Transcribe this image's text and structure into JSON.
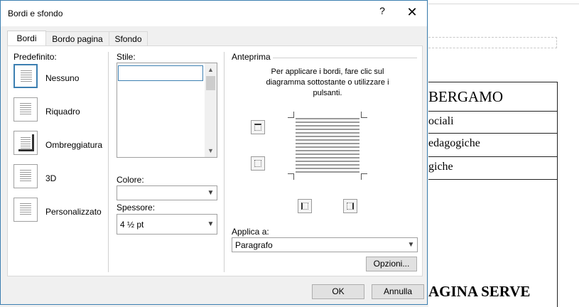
{
  "dialog": {
    "title": "Bordi e sfondo",
    "help": "?",
    "close": "✕"
  },
  "tabs": [
    {
      "label": "Bordi"
    },
    {
      "label": "Bordo pagina"
    },
    {
      "label": "Sfondo"
    }
  ],
  "presets": {
    "label": "Predefinito:",
    "items": [
      {
        "label": "Nessuno"
      },
      {
        "label": "Riquadro"
      },
      {
        "label": "Ombreggiatura"
      },
      {
        "label": "3D"
      },
      {
        "label": "Personalizzato"
      }
    ]
  },
  "style": {
    "label": "Stile:",
    "color_label": "Colore:",
    "color_value": "",
    "width_label": "Spessore:",
    "width_value": "4 ½ pt"
  },
  "preview": {
    "label": "Anteprima",
    "hint": "Per applicare i bordi, fare clic sul diagramma sottostante o utilizzare i pulsanti.",
    "apply_label": "Applica a:",
    "apply_value": "Paragrafo",
    "options_label": "Opzioni..."
  },
  "footer": {
    "ok": "OK",
    "cancel": "Annulla"
  },
  "document": {
    "row1": "BERGAMO",
    "row2": "ociali",
    "row3": "edagogiche",
    "row4": "giche",
    "bottom": "AGINA SERVE"
  },
  "colors": {
    "accent": "#3c7fb1",
    "panel": "#ffffff",
    "chrome": "#f0f0f0"
  }
}
